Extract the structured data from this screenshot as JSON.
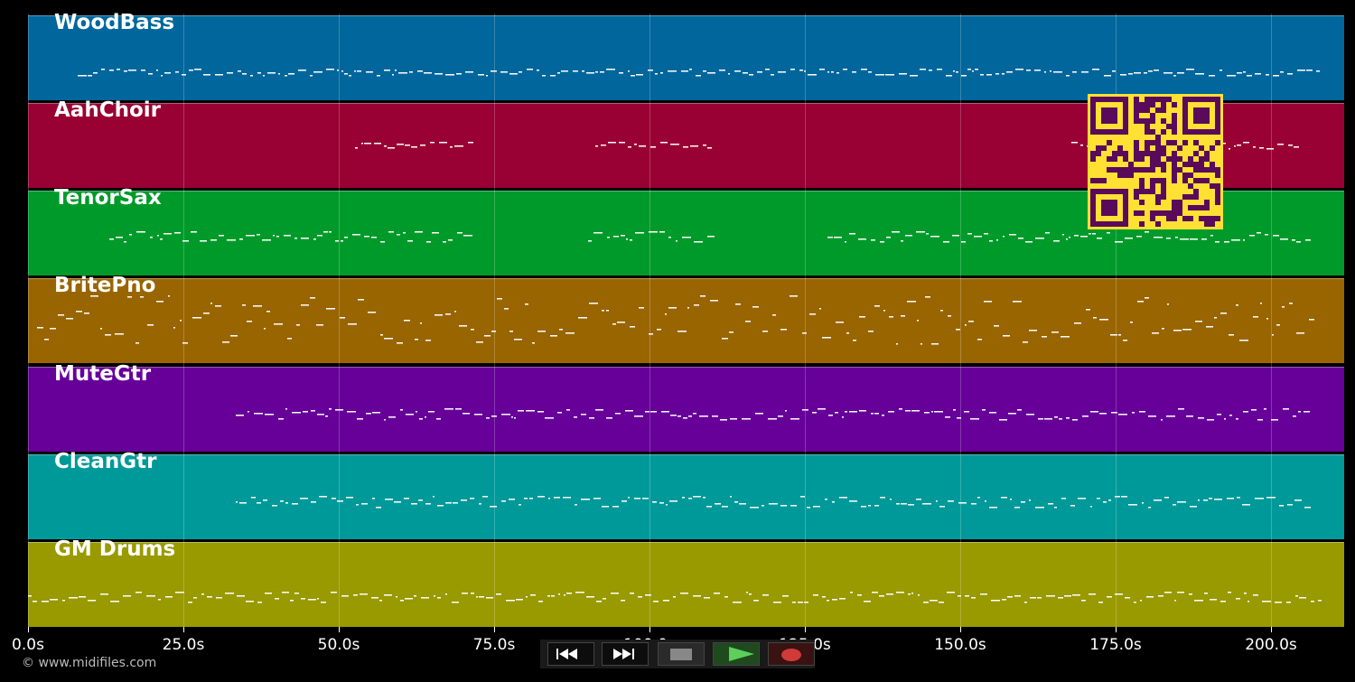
{
  "tracks": [
    {
      "name": "WoodBass",
      "color": "#00669b"
    },
    {
      "name": "AahChoir",
      "color": "#990033"
    },
    {
      "name": "TenorSax",
      "color": "#009a2a"
    },
    {
      "name": "BritePno",
      "color": "#996500"
    },
    {
      "name": "MuteGtr",
      "color": "#660099"
    },
    {
      "name": "CleanGtr",
      "color": "#009999"
    },
    {
      "name": "GM Drums",
      "color": "#999900"
    }
  ],
  "timeline": {
    "ticks": [
      "0.0s",
      "25.0s",
      "50.0s",
      "75.0s",
      "100.0s",
      "125.0s",
      "150.0s",
      "175.0s",
      "200.0s"
    ]
  },
  "copyright": "© www.midifiles.com",
  "transport": {
    "buttons": [
      {
        "name": "rewind",
        "icon": "rewind-icon",
        "accent": "#ffffff"
      },
      {
        "name": "fast-forward",
        "icon": "fast-forward-icon",
        "accent": "#ffffff"
      },
      {
        "name": "stop",
        "icon": "stop-icon",
        "accent": "#888888"
      },
      {
        "name": "play",
        "icon": "play-icon",
        "accent": "#5ccf5c"
      },
      {
        "name": "record",
        "icon": "record-icon",
        "accent": "#d23a3a"
      }
    ]
  },
  "qr": {
    "color": "#ffe033",
    "dark": "#5a0a5a"
  }
}
